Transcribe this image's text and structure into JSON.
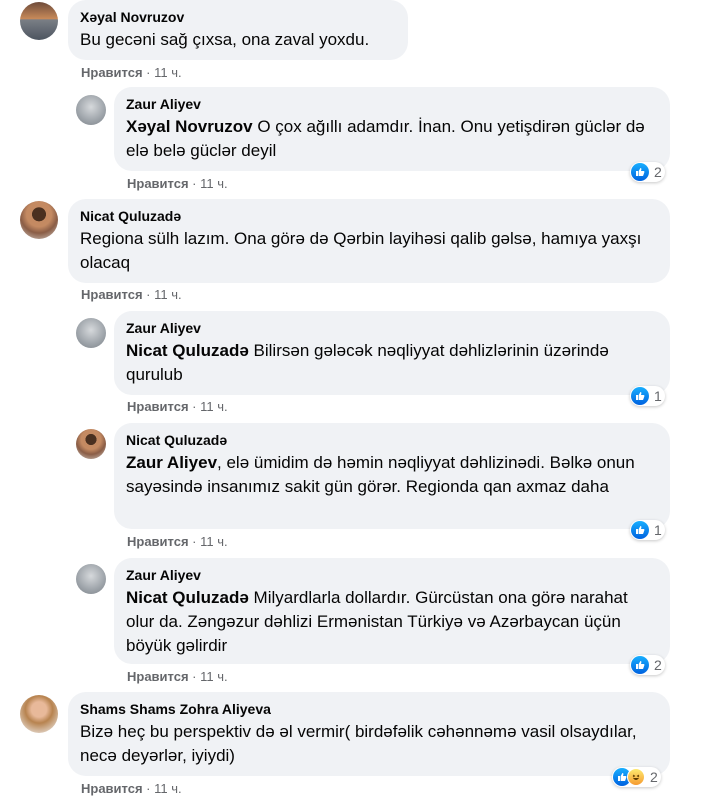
{
  "comments": [
    {
      "author": "Xəyal Novruzov",
      "text": "Bu gecəni sağ çıxsa, ona zaval yoxdu.",
      "like_label": "Нравится",
      "time": "11 ч."
    },
    {
      "author": "Zaur Aliyev",
      "mention": "Xəyal Novruzov",
      "text": " O çox ağıllı adamdır. İnan. Onu yetişdirən güclər də elə belə güclər deyil",
      "like_label": "Нравится",
      "time": "11 ч.",
      "reaction_count": "2"
    },
    {
      "author": "Nicat Quluzadə",
      "text": "Regiona sülh lazım. Ona görə də Qərbin layihəsi qalib gəlsə, hamıya yaxşı olacaq",
      "like_label": "Нравится",
      "time": "11 ч."
    },
    {
      "author": "Zaur Aliyev",
      "mention": "Nicat Quluzadə",
      "text": " Bilirsən gələcək nəqliyyat dəhlizlərinin üzərində qurulub",
      "like_label": "Нравится",
      "time": "11 ч.",
      "reaction_count": "1"
    },
    {
      "author": "Nicat Quluzadə",
      "mention": "Zaur Aliyev",
      "text": ", elə ümidim də həmin nəqliyyat dəhlizinədi. Bəlkə onun sayəsində insanımız sakit gün görər. Regionda qan axmaz daha",
      "like_label": "Нравится",
      "time": "11 ч.",
      "reaction_count": "1"
    },
    {
      "author": "Zaur Aliyev",
      "mention": "Nicat Quluzadə",
      "text": " Milyardlarla dollardır. Gürcüstan ona görə narahat olur da. Zəngəzur dəhlizi Ermənistan Türkiyə və Azərbaycan üçün böyük gəlirdir",
      "like_label": "Нравится",
      "time": "11 ч.",
      "reaction_count": "2"
    },
    {
      "author": "Shams Shams Zohra Aliyeva",
      "text": "Bizə heç bu perspektiv də əl vermir( birdəfəlik cəhənnəmə vasil olsaydılar, necə deyərlər, iyiydi)",
      "like_label": "Нравится",
      "time": "11 ч.",
      "reaction_count": "2"
    }
  ],
  "separator": " · ",
  "colors": {
    "bubble": "#f0f2f5",
    "meta_text": "#65676b",
    "like_blue": "#1877f2"
  }
}
